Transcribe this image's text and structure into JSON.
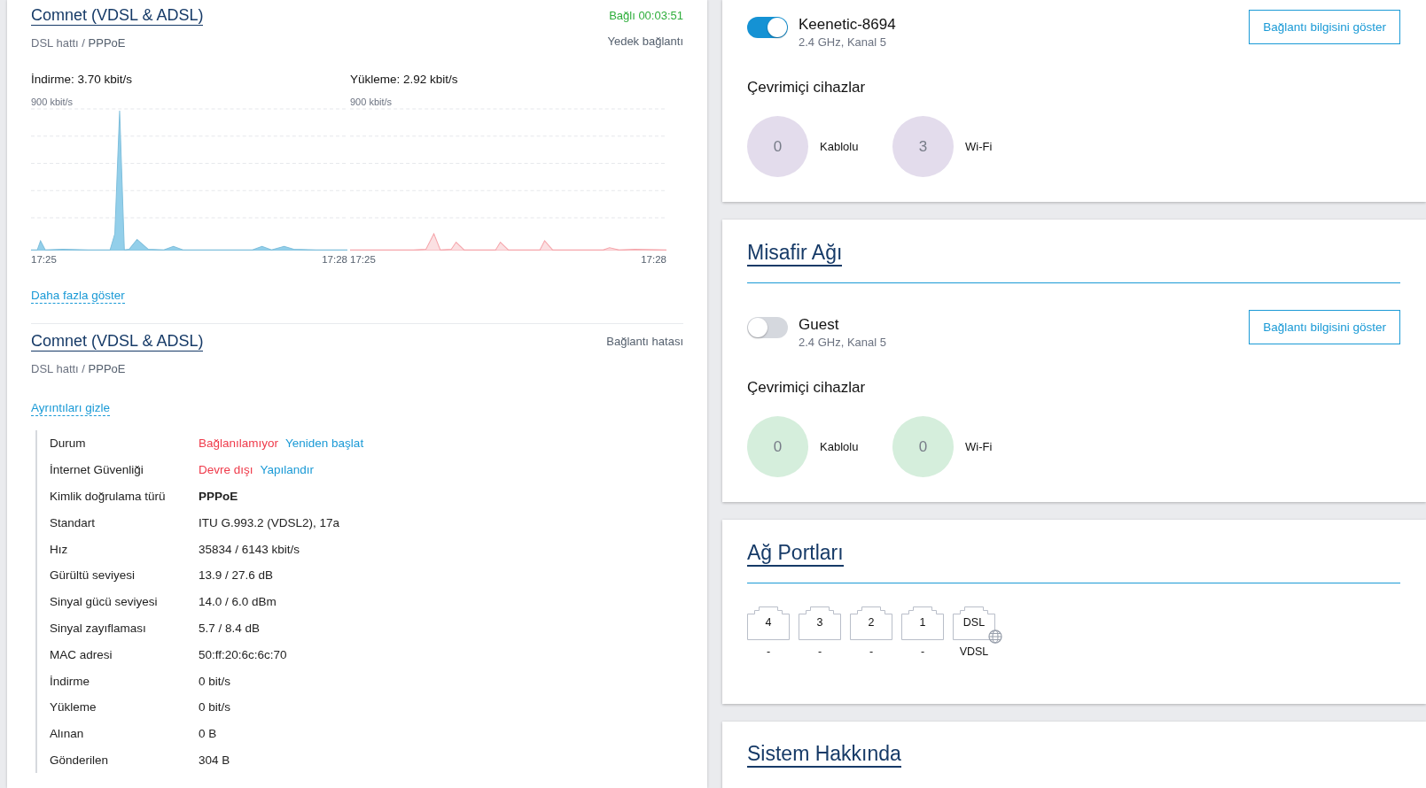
{
  "internet": {
    "connections": [
      {
        "title": "Comnet (VDSL & ADSL)",
        "status": "Bağlı 00:03:51",
        "connected": true,
        "line": "DSL hattı / ",
        "protocol": "PPPoE",
        "role": "Yedek bağlantı",
        "traffic": [
          {
            "label": "İndirme: 3.70 kbit/s",
            "scale": "900 kbit/s",
            "time_start": "17:25",
            "time_end": "17:28",
            "kind": "download"
          },
          {
            "label": "Yükleme: 2.92 kbit/s",
            "scale": "900 kbit/s",
            "time_start": "17:25",
            "time_end": "17:28",
            "kind": "upload"
          }
        ],
        "toggle_link": "Daha fazla göster"
      },
      {
        "title": "Comnet (VDSL & ADSL)",
        "status": "Bağlantı hatası",
        "connected": false,
        "line": "DSL hattı / ",
        "protocol": "PPPoE",
        "toggle_link": "Ayrıntıları gizle",
        "details": [
          {
            "label": "Durum",
            "kind": "status",
            "status": "Bağlanılamıyor",
            "action": "Yeniden başlat"
          },
          {
            "label": "İnternet Güvenliği",
            "kind": "status",
            "status": "Devre dışı",
            "action": "Yapılandır"
          },
          {
            "label": "Kimlik doğrulama türü",
            "kind": "strong",
            "value": "PPPoE"
          },
          {
            "label": "Standart",
            "kind": "text",
            "value": "ITU G.993.2 (VDSL2), 17a"
          },
          {
            "label": "Hız",
            "kind": "text",
            "value": "35834 / 6143 kbit/s"
          },
          {
            "label": "Gürültü seviyesi",
            "kind": "text",
            "value": "13.9 / 27.6 dB"
          },
          {
            "label": "Sinyal gücü seviyesi",
            "kind": "text",
            "value": "14.0 / 6.0 dBm"
          },
          {
            "label": "Sinyal zayıflaması",
            "kind": "text",
            "value": "5.7 / 8.4 dB"
          },
          {
            "label": "MAC adresi",
            "kind": "text",
            "value": "50:ff:20:6c:6c:70"
          },
          {
            "label": "İndirme",
            "kind": "text",
            "value": "0 bit/s"
          },
          {
            "label": "Yükleme",
            "kind": "text",
            "value": "0 bit/s"
          },
          {
            "label": "Alınan",
            "kind": "text",
            "value": "0 B"
          },
          {
            "label": "Gönderilen",
            "kind": "text",
            "value": "304 B"
          }
        ]
      }
    ]
  },
  "networks": [
    {
      "ssid": "Keenetic-8694",
      "band": "2.4 GHz, Kanal 5",
      "on": true,
      "button": "Bağlantı bilgisini göster",
      "devices_title": "Çevrimiçi cihazlar",
      "color": "#e3dcec",
      "devices": [
        {
          "count": "0",
          "label": "Kablolu"
        },
        {
          "count": "3",
          "label": "Wi-Fi"
        }
      ]
    },
    {
      "title": "Misafir Ağı",
      "ssid": "Guest",
      "band": "2.4 GHz, Kanal 5",
      "on": false,
      "button": "Bağlantı bilgisini göster",
      "devices_title": "Çevrimiçi cihazlar",
      "color": "#d5eedc",
      "devices": [
        {
          "count": "0",
          "label": "Kablolu"
        },
        {
          "count": "0",
          "label": "Wi-Fi"
        }
      ]
    }
  ],
  "ports": {
    "title": "Ağ Portları",
    "items": [
      {
        "label": "4",
        "status": "-",
        "kind": "lan"
      },
      {
        "label": "3",
        "status": "-",
        "kind": "lan"
      },
      {
        "label": "2",
        "status": "-",
        "kind": "lan"
      },
      {
        "label": "1",
        "status": "-",
        "kind": "lan"
      },
      {
        "label": "DSL",
        "status": "VDSL",
        "kind": "wan"
      }
    ]
  },
  "system": {
    "title": "Sistem Hakkında"
  }
}
